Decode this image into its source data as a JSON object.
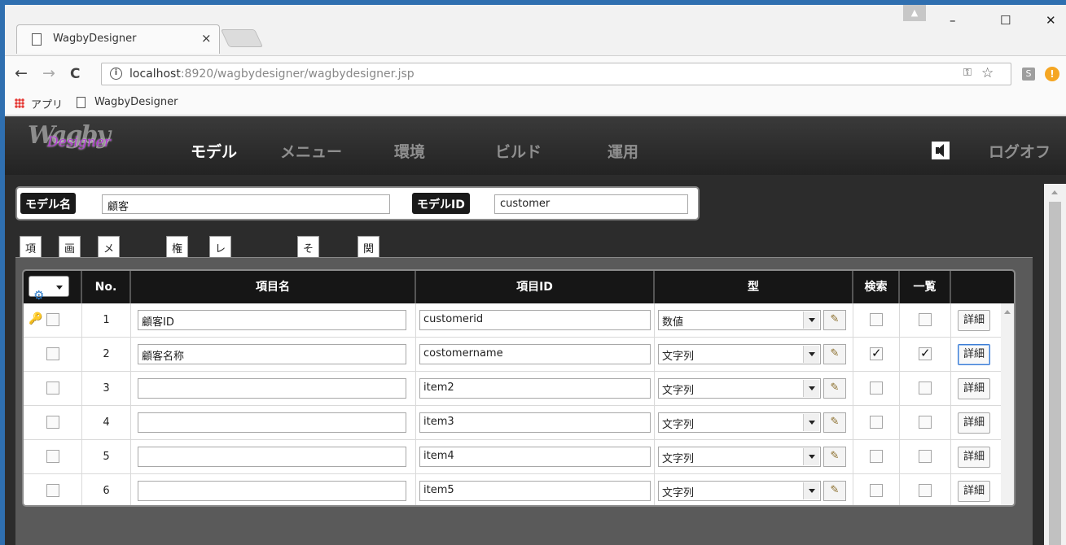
{
  "browser": {
    "tab_title": "WagbyDesigner",
    "tab_close": "×",
    "profile_icon": "person-icon",
    "window_controls": {
      "minimize": "–",
      "maximize": "☐",
      "close": "✕"
    },
    "nav": {
      "back": "←",
      "forward": "→",
      "reload": "C"
    },
    "url_host": "localhost",
    "url_rest": ":8920/wagbydesigner/wagbydesigner.jsp",
    "info_glyph": "i",
    "ext_s": "S",
    "ext_alert": "!",
    "bookmarks": {
      "apps_label": "アプリ",
      "page_label": "WagbyDesigner"
    }
  },
  "app": {
    "logo_main": "Wagby",
    "logo_sub": "Designer",
    "nav": [
      "モデル",
      "メニュー",
      "環境",
      "ビルド",
      "運用"
    ],
    "active_nav": "モデル",
    "logoff": "ログオフ"
  },
  "model": {
    "name_label": "モデル名",
    "name_value": "顧客",
    "id_label": "モデルID",
    "id_value": "customer"
  },
  "tabs": [
    "項目",
    "画面",
    "メール",
    "権限",
    "レイアウト",
    "その他",
    "関連図"
  ],
  "grid": {
    "headers": {
      "no": "No.",
      "name": "項目名",
      "id": "項目ID",
      "type": "型",
      "search": "検索",
      "list": "一覧"
    },
    "detail_label": "詳細",
    "rows": [
      {
        "no": "1",
        "name": "顧客ID",
        "id": "customerid",
        "type": "数値",
        "key": true,
        "search": false,
        "list": false
      },
      {
        "no": "2",
        "name": "顧客名称",
        "id": "costomername",
        "type": "文字列",
        "key": false,
        "search": true,
        "list": true,
        "detail_focused": true
      },
      {
        "no": "3",
        "name": "",
        "id": "item2",
        "type": "文字列",
        "key": false,
        "search": false,
        "list": false
      },
      {
        "no": "4",
        "name": "",
        "id": "item3",
        "type": "文字列",
        "key": false,
        "search": false,
        "list": false
      },
      {
        "no": "5",
        "name": "",
        "id": "item4",
        "type": "文字列",
        "key": false,
        "search": false,
        "list": false
      },
      {
        "no": "6",
        "name": "",
        "id": "item5",
        "type": "文字列",
        "key": false,
        "search": false,
        "list": false
      }
    ]
  }
}
